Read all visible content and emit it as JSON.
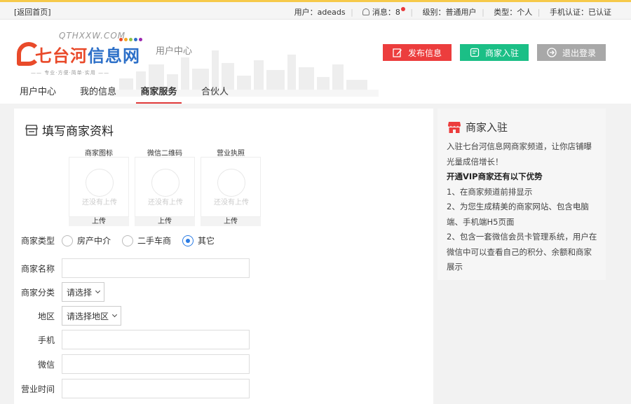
{
  "topbar": {
    "back_link": "[返回首页]",
    "user": "用户：adeads",
    "messages": "消息：8",
    "level": "级别：普通用户",
    "type": "类型：个人",
    "phone_verify": "手机认证：已认证"
  },
  "header": {
    "logo_site": "QTHXXW.COM",
    "logo_name_part1": "七台河",
    "logo_name_part2": "信息网",
    "logo_slogan": "—— 专业·方便·简单·实用 ——",
    "center_label": "用户中心",
    "buttons": {
      "post": "发布信息",
      "merchant": "商家入驻",
      "logout": "退出登录"
    }
  },
  "nav": {
    "tabs": [
      {
        "label": "用户中心"
      },
      {
        "label": "我的信息"
      },
      {
        "label": "商家服务"
      },
      {
        "label": "合伙人"
      }
    ],
    "active_tab": "商家服务"
  },
  "form": {
    "title": "填写商家资料",
    "uploads": [
      {
        "label": "商家图标",
        "placeholder": "还没有上传",
        "button": "上传"
      },
      {
        "label": "微信二维码",
        "placeholder": "还没有上传",
        "button": "上传"
      },
      {
        "label": "营业执照",
        "placeholder": "还没有上传",
        "button": "上传"
      }
    ],
    "merchant_type": {
      "label": "商家类型",
      "options": [
        "房产中介",
        "二手车商",
        "其它"
      ],
      "selected": "其它"
    },
    "merchant_name": {
      "label": "商家名称",
      "value": ""
    },
    "category": {
      "label": "商家分类",
      "selected": "请选择"
    },
    "region": {
      "label": "地区",
      "selected": "请选择地区"
    },
    "phone": {
      "label": "手机",
      "value": ""
    },
    "wechat": {
      "label": "微信",
      "value": ""
    },
    "business_hours": {
      "label": "营业时间",
      "value": ""
    }
  },
  "sidebar": {
    "title": "商家入驻",
    "lines": [
      "入驻七台河信息网商家频道，让你店铺曝",
      "光量成倍增长！",
      "开通VIP商家还有以下优势",
      "1、在商家频道前排显示",
      "2、为您生成精美的商家网站、包含电脑",
      "端、手机端H5页面",
      "2、包含一套微信会员卡管理系统，用户在",
      "微信中可以查看自己的积分、余额和商家",
      "展示"
    ]
  },
  "colors": {
    "accent_red": "#ec3d3d",
    "merchant_green": "#1bbf86",
    "logout_gray": "#a8a8a8",
    "radio_blue": "#2a7be4",
    "logo_red": "#e94a2a",
    "logo_blue": "#2c6fc8"
  }
}
